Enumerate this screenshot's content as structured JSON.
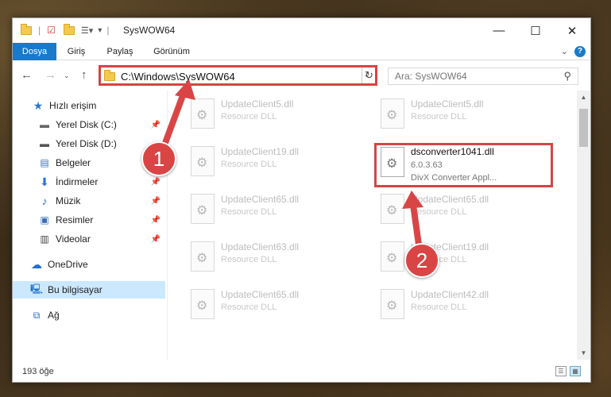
{
  "window": {
    "title": "SysWOW64",
    "minimize": "—",
    "maximize": "☐",
    "close": "✕"
  },
  "ribbon": {
    "tabs": [
      "Dosya",
      "Giriş",
      "Paylaş",
      "Görünüm"
    ],
    "help": "?"
  },
  "nav": {
    "address": "C:\\Windows\\SysWOW64",
    "search_placeholder": "Ara: SysWOW64"
  },
  "sidebar": {
    "items": [
      {
        "label": "Hızlı erişim",
        "icon": "star-icon"
      },
      {
        "label": "Yerel Disk (C:)",
        "icon": "drive-icon",
        "pinned": true
      },
      {
        "label": "Yerel Disk (D:)",
        "icon": "drive-icon"
      },
      {
        "label": "Belgeler",
        "icon": "documents-icon",
        "pinned": true
      },
      {
        "label": "İndirmeler",
        "icon": "download-icon",
        "pinned": true
      },
      {
        "label": "Müzik",
        "icon": "music-icon",
        "pinned": true
      },
      {
        "label": "Resimler",
        "icon": "pictures-icon",
        "pinned": true
      },
      {
        "label": "Videolar",
        "icon": "videos-icon",
        "pinned": true
      },
      {
        "label": "OneDrive",
        "icon": "cloud-icon"
      },
      {
        "label": "Bu bilgisayar",
        "icon": "computer-icon",
        "selected": true
      },
      {
        "label": "Ağ",
        "icon": "network-icon"
      }
    ]
  },
  "files": {
    "left": [
      {
        "name": "UpdateClient5.dll",
        "type": "Resource DLL"
      },
      {
        "name": "UpdateClient19.dll",
        "type": "Resource DLL"
      },
      {
        "name": "UpdateClient65.dll",
        "type": "Resource DLL"
      },
      {
        "name": "UpdateClient63.dll",
        "type": "Resource DLL"
      },
      {
        "name": "UpdateClient65.dll",
        "type": "Resource DLL"
      }
    ],
    "right": [
      {
        "name": "UpdateClient5.dll",
        "type": "Resource DLL"
      },
      {
        "name": "dsconverter1041.dll",
        "version": "6.0.3.63",
        "type": "DivX Converter Appl...",
        "highlighted": true
      },
      {
        "name": "UpdateClient65.dll",
        "type": "Resource DLL"
      },
      {
        "name": "UpdateClient19.dll",
        "type": "Resource DLL"
      },
      {
        "name": "UpdateClient42.dll",
        "type": "Resource DLL"
      }
    ]
  },
  "status": {
    "count": "193 öğe"
  },
  "annotations": {
    "marker1": "1",
    "marker2": "2",
    "color": "#d94545"
  }
}
